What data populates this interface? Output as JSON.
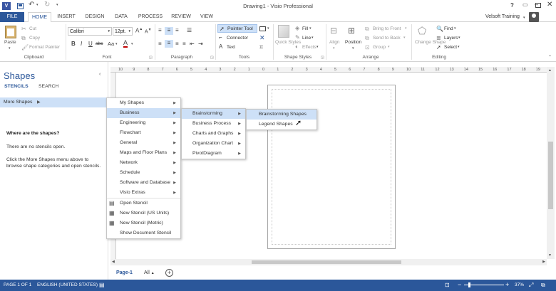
{
  "window": {
    "title": "Drawing1 - Visio Professional",
    "user": "Velsoft Training",
    "help": "?"
  },
  "quick_access": {
    "app_icon": "visio-icon",
    "save": "save-icon",
    "undo": "undo-icon",
    "redo": "redo-icon"
  },
  "tabs": {
    "file": "FILE",
    "items": [
      "HOME",
      "INSERT",
      "DESIGN",
      "DATA",
      "PROCESS",
      "REVIEW",
      "VIEW"
    ],
    "active": "HOME"
  },
  "ribbon": {
    "clipboard": {
      "paste": "Paste",
      "cut": "Cut",
      "copy": "Copy",
      "format_painter": "Format Painter",
      "label": "Clipboard"
    },
    "font": {
      "name": "Calibri",
      "size": "12pt.",
      "bold": "B",
      "italic": "I",
      "underline": "U",
      "strike": "abc",
      "case": "Aa",
      "label": "Font"
    },
    "paragraph": {
      "label": "Paragraph"
    },
    "tools": {
      "pointer": "Pointer Tool",
      "connector": "Connector",
      "text": "Text",
      "label": "Tools"
    },
    "shape_styles": {
      "quick_styles": "Quick Styles",
      "fill": "Fill",
      "line": "Line",
      "effects": "Effects",
      "label": "Shape Styles"
    },
    "arrange": {
      "align": "Align",
      "position": "Position",
      "bring_to_front": "Bring to Front",
      "send_to_back": "Send to Back",
      "group": "Group",
      "label": "Arrange"
    },
    "editing": {
      "change_shape": "Change Shape",
      "find": "Find",
      "layers": "Layers",
      "select": "Select",
      "label": "Editing"
    }
  },
  "shapes_panel": {
    "title": "Shapes",
    "tabs": [
      "STENCILS",
      "SEARCH"
    ],
    "more_shapes": "More Shapes",
    "where_title": "Where are the shapes?",
    "no_stencils": "There are no stencils open.",
    "help_text": "Click the More Shapes menu above to browse shape categories and open stencils."
  },
  "menu_main": {
    "items": [
      "My Shapes",
      "Business",
      "Engineering",
      "Flowchart",
      "General",
      "Maps and Floor Plans",
      "Network",
      "Schedule",
      "Software and Database",
      "Visio Extras"
    ],
    "actions": [
      "Open Stencil",
      "New Stencil (US Units)",
      "New Stencil (Metric)",
      "Show Document Stencil"
    ]
  },
  "menu_business": {
    "items": [
      "Brainstorming",
      "Business Process",
      "Charts and Graphs",
      "Organization Chart",
      "PivotDiagram"
    ]
  },
  "menu_brainstorming": {
    "items": [
      "Brainstorming Shapes",
      "Legend Shapes"
    ]
  },
  "ruler": {
    "labels": [
      "10",
      "9",
      "8",
      "7",
      "6",
      "5",
      "4",
      "3",
      "2",
      "1",
      "0",
      "1",
      "2",
      "3",
      "4",
      "5",
      "6",
      "7",
      "8",
      "9",
      "10",
      "11",
      "12",
      "13",
      "14",
      "15",
      "16",
      "17",
      "18",
      "19"
    ]
  },
  "page_tabs": {
    "current": "Page-1",
    "all": "All"
  },
  "status": {
    "page": "PAGE 1 OF 1",
    "language": "ENGLISH (UNITED STATES)",
    "zoom": "37%"
  },
  "colors": {
    "accent": "#2b579a",
    "highlight": "#cde0f7"
  }
}
